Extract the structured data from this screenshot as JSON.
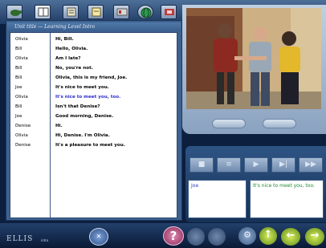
{
  "app": {
    "brand": "ELLIS",
    "brand_sub": "intro"
  },
  "toolbar": {
    "icons": [
      "turtle-icon",
      "book-icon",
      "dictionary-icon",
      "notepad-icon",
      "grammar-icon",
      "globe-icon",
      "map-icon"
    ]
  },
  "transcript": {
    "subtitle": "Unit title — Learning Level Intro",
    "lines": [
      {
        "speaker": "Olivia",
        "text": "Hi, Bill.",
        "highlighted": false
      },
      {
        "speaker": "Bill",
        "text": "Hello, Olivia.",
        "highlighted": false
      },
      {
        "speaker": "Olivia",
        "text": "Am I late?",
        "highlighted": false
      },
      {
        "speaker": "Bill",
        "text": "No, you're not.",
        "highlighted": false
      },
      {
        "speaker": "Bill",
        "text": "Olivia, this is my friend, Joe.",
        "highlighted": false
      },
      {
        "speaker": "Joe",
        "text": "It's nice to meet you.",
        "highlighted": false
      },
      {
        "speaker": "Olivia",
        "text": "It's nice to meet you, too.",
        "highlighted": true
      },
      {
        "speaker": "Bill",
        "text": "Isn't that Denise?",
        "highlighted": false
      },
      {
        "speaker": "Joe",
        "text": "Good morning, Denise.",
        "highlighted": false
      },
      {
        "speaker": "Denise",
        "text": "Hi.",
        "highlighted": false
      },
      {
        "speaker": "Olivia",
        "text": "Hi, Denise.  I'm Olivia.",
        "highlighted": false
      },
      {
        "speaker": "Denise",
        "text": "It's a pleasure to meet you.",
        "highlighted": false
      }
    ]
  },
  "practice": {
    "speaker": "Joe",
    "response": "It's nice to meet you, too."
  },
  "colors": {
    "highlight": "#2a2acf",
    "response": "#1e8a2e",
    "speaker_answer": "#2a3fbf"
  }
}
